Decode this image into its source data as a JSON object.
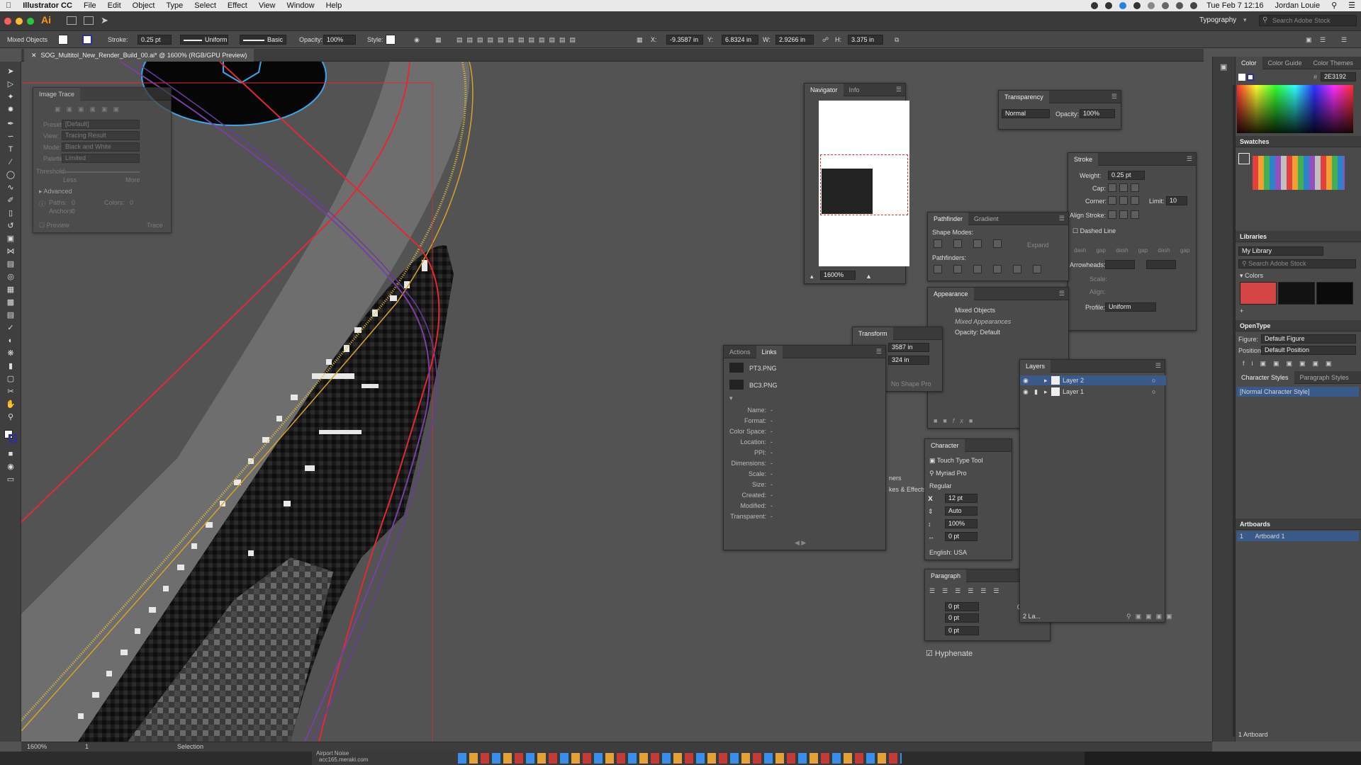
{
  "menubar": {
    "app": "Illustrator CC",
    "items": [
      "File",
      "Edit",
      "Object",
      "Type",
      "Select",
      "Effect",
      "View",
      "Window",
      "Help"
    ],
    "datetime": "Tue Feb 7  12:16",
    "user": "Jordan Louie"
  },
  "appbar": {
    "logo": "Ai",
    "workspace": "Typography",
    "search_placeholder": "Search Adobe Stock"
  },
  "controlbar": {
    "selection": "Mixed Objects",
    "stroke_label": "Stroke:",
    "stroke_value": "0.25 pt",
    "profile": "Uniform",
    "brush": "Basic",
    "opacity_label": "Opacity:",
    "opacity_value": "100%",
    "style_label": "Style:",
    "x_label": "X:",
    "x_value": "-9.3587 in",
    "y_label": "Y:",
    "y_value": "6.8324 in",
    "w_label": "W:",
    "w_value": "2.9266 in",
    "h_label": "H:",
    "h_value": "3.375 in"
  },
  "document": {
    "tab_title": "SOG_Multitol_New_Render_Build_00.ai* @ 1600% (RGB/GPU Preview)",
    "zoom": "1600%",
    "artboard_num": "1",
    "tool_status": "Selection"
  },
  "image_trace": {
    "title": "Image Trace",
    "preset_label": "Preset:",
    "preset_value": "[Default]",
    "view_label": "View:",
    "view_value": "Tracing Result",
    "mode_label": "Mode:",
    "mode_value": "Black and White",
    "palette_label": "Palette:",
    "palette_value": "Limited",
    "threshold_label": "Threshold:",
    "less": "Less",
    "more": "More",
    "advanced": "Advanced",
    "paths_label": "Paths:",
    "paths_value": "0",
    "colors_label": "Colors:",
    "colors_value": "0",
    "anchors_label": "Anchors:",
    "anchors_value": "0",
    "preview": "Preview",
    "trace": "Trace"
  },
  "navigator": {
    "tabs": [
      "Navigator",
      "Info"
    ],
    "zoom": "1600%"
  },
  "transparency": {
    "title": "Transparency",
    "mode": "Normal",
    "opacity_label": "Opacity:",
    "opacity_value": "100%"
  },
  "stroke_panel": {
    "title": "Stroke",
    "weight_label": "Weight:",
    "weight_value": "0.25 pt",
    "cap_label": "Cap:",
    "corner_label": "Corner:",
    "limit_label": "Limit:",
    "limit_value": "10",
    "align_label": "Align Stroke:",
    "dashed": "Dashed Line",
    "dash_labels": [
      "dash",
      "gap",
      "dash",
      "gap",
      "dash",
      "gap"
    ],
    "arrowheads_label": "Arrowheads:",
    "scale_label": "Scale:",
    "align2_label": "Align:",
    "profile_label": "Profile:",
    "profile_value": "Uniform"
  },
  "pathfinder": {
    "tabs": [
      "Pathfinder",
      "Gradient"
    ],
    "shape_modes": "Shape Modes:",
    "expand": "Expand",
    "pathfinders": "Pathfinders:"
  },
  "appearance": {
    "title": "Appearance",
    "item": "Mixed Objects",
    "sub": "Mixed Appearances",
    "opacity": "Opacity: Default"
  },
  "transform": {
    "title": "Transform",
    "x_partial": "3587 in",
    "y_partial": "324 in",
    "no_shape": "No Shape Pro"
  },
  "links": {
    "tabs": [
      "Actions",
      "Links"
    ],
    "files": [
      "PT3.PNG",
      "BC3.PNG"
    ],
    "fields": [
      "Name:",
      "Format:",
      "Color Space:",
      "Location:",
      "PPI:",
      "Dimensions:",
      "Scale:",
      "Size:",
      "Created:",
      "Modified:",
      "Transparent:"
    ],
    "dash": "-"
  },
  "character": {
    "title": "Character",
    "touch_type": "Touch Type Tool",
    "font": "Myriad Pro",
    "style": "Regular",
    "size": "12 pt",
    "leading": "Auto",
    "scale": "100%",
    "tracking": "0 pt",
    "language": "English: USA"
  },
  "paragraph": {
    "title": "Paragraph",
    "indent1": "0 pt",
    "indent2": "0 pt",
    "space": "0 pt",
    "right_val": "0",
    "hyphenate": "Hyphenate"
  },
  "layers": {
    "title": "Layers",
    "items": [
      "Layer 2",
      "Layer 1"
    ],
    "footer": "2 La..."
  },
  "ghost_labels": {
    "corners": "ners",
    "strokes": "kes & Effects"
  },
  "right_dock": {
    "color_tabs": [
      "Color",
      "Color Guide",
      "Color Themes"
    ],
    "hex": "2E3192",
    "swatches": "Swatches",
    "libraries": "Libraries",
    "library_name": "My Library",
    "search_placeholder": "Search Adobe Stock",
    "colors_group": "Colors",
    "lib_colors": [
      "#d64545",
      "#121212",
      "#0b0b0b"
    ],
    "opentype": "OpenType",
    "figure_label": "Figure:",
    "figure_value": "Default Figure",
    "position_label": "Position:",
    "position_value": "Default Position",
    "char_styles": "Character Styles",
    "para_styles": "Paragraph Styles",
    "normal_style": "[Normal Character Style]",
    "artboards": "Artboards",
    "artboard_num": "1",
    "artboard_name": "Artboard 1",
    "artboard_count": "1 Artboard"
  },
  "dock_bar": {
    "label1": "Airport Noise",
    "label2": "acc165.meraki.com"
  }
}
